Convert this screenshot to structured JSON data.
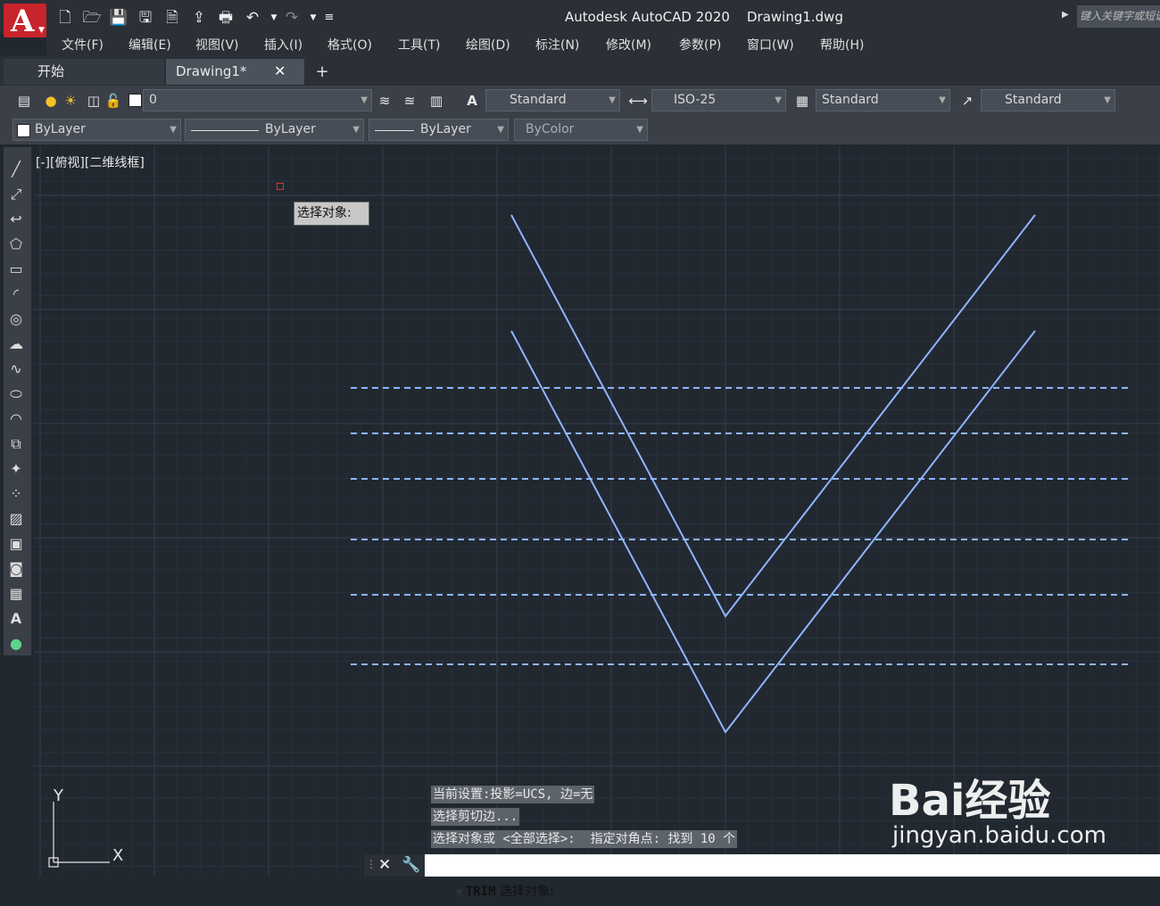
{
  "app": {
    "logo_letter": "A",
    "title": "Autodesk AutoCAD 2020    Drawing1.dwg",
    "search_placeholder": "键入关键字或短语"
  },
  "menu": [
    "文件(F)",
    "编辑(E)",
    "视图(V)",
    "插入(I)",
    "格式(O)",
    "工具(T)",
    "绘图(D)",
    "标注(N)",
    "修改(M)",
    "参数(P)",
    "窗口(W)",
    "帮助(H)"
  ],
  "tabs": {
    "start": "开始",
    "drawing": "Drawing1*",
    "close": "✕",
    "add": "+"
  },
  "toolbar1": {
    "layer": "0",
    "text_style": "Standard",
    "dim_style": "ISO-25",
    "table_style": "Standard",
    "mleader_style": "Standard"
  },
  "toolbar2": {
    "color": "ByLayer",
    "linetype": "ByLayer",
    "lineweight": "ByLayer",
    "plot_style": "ByColor"
  },
  "viewport": {
    "label": "[-][俯视][二维线框]",
    "tooltip": "选择对象:"
  },
  "ucs": {
    "y_label": "Y",
    "x_label": "X"
  },
  "command_history": [
    "当前设置:投影=UCS, 边=无",
    "选择剪切边...",
    "选择对象或 <全部选择>:  指定对角点: 找到 10 个"
  ],
  "command_line": {
    "command": "TRIM",
    "prompt": "选择对象:"
  },
  "watermark": {
    "logo": "Bai经验",
    "url": "jingyan.baidu.com"
  },
  "colors": {
    "canvas": "#212830",
    "grid": "#2c3440",
    "geometry": "#8fb4ff",
    "dashed": "#8fb4ff"
  }
}
